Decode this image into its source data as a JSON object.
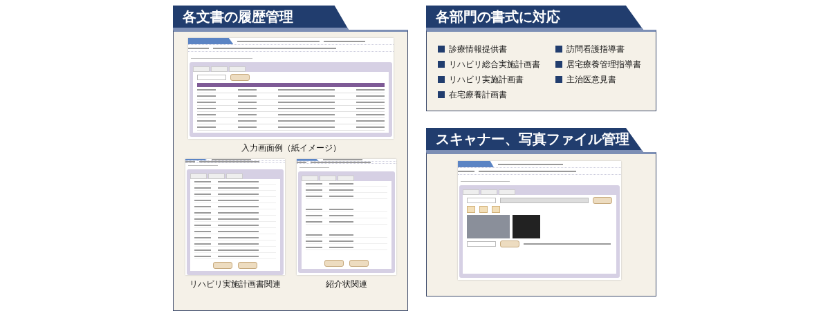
{
  "history_panel": {
    "title": "各文書の履歴管理",
    "main_figure": {
      "kind": "table",
      "caption": "入力画面例（紙イメージ）"
    },
    "sub_figures": [
      {
        "kind": "form",
        "caption": "リハビリ実施計画書関連"
      },
      {
        "kind": "letter",
        "caption": "紹介状関連"
      }
    ]
  },
  "formats_panel": {
    "title": "各部門の書式に対応",
    "items": [
      "診療情報提供書",
      "リハビリ総合実施計画書",
      "リハビリ実施計画書",
      "在宅療養計画書",
      "訪問看護指導書",
      "居宅療養管理指導書",
      "主治医意見書"
    ]
  },
  "scanner_panel": {
    "title": "スキャナー、写真ファイル管理",
    "figure": {
      "kind": "files"
    }
  }
}
